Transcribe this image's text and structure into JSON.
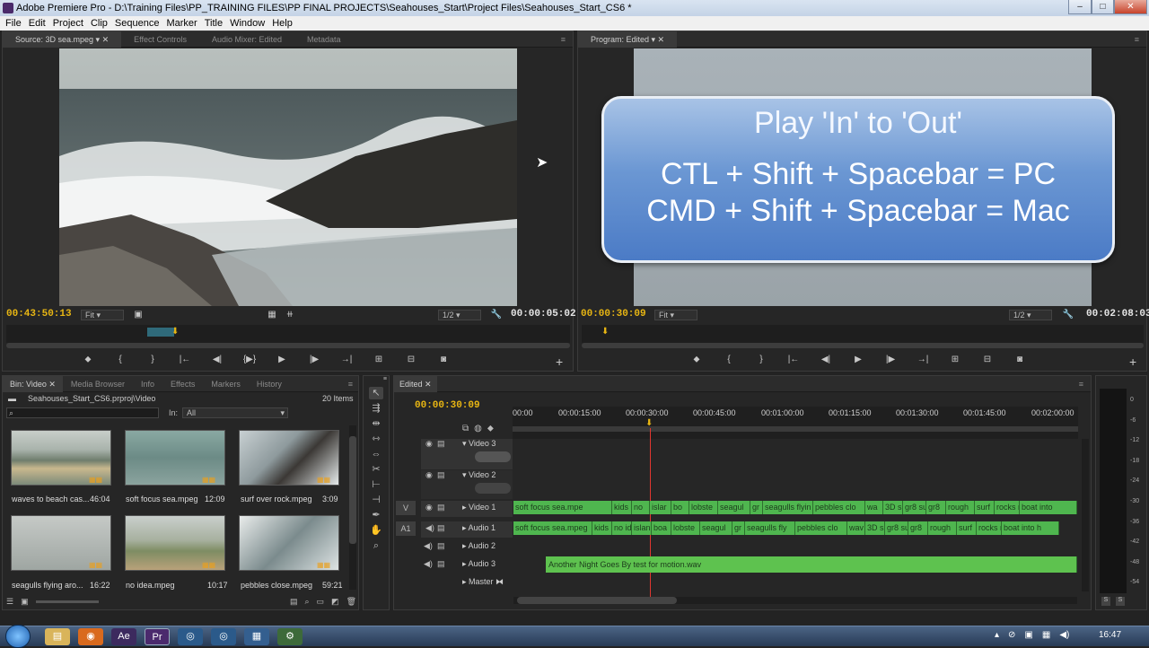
{
  "window": {
    "title": "Adobe Premiere Pro - D:\\Training Files\\PP_TRAINING FILES\\PP FINAL PROJECTS\\Seahouses_Start\\Project Files\\Seahouses_Start_CS6 *",
    "minimize": "–",
    "maximize": "□",
    "close": "✕"
  },
  "menu": [
    "File",
    "Edit",
    "Project",
    "Clip",
    "Sequence",
    "Marker",
    "Title",
    "Window",
    "Help"
  ],
  "source": {
    "tabs": [
      "Source: 3D sea.mpeg",
      "Effect Controls",
      "Audio Mixer: Edited",
      "Metadata"
    ],
    "timecode_in": "00:43:50:13",
    "fit": "Fit",
    "resolution": "1/2",
    "duration": "00:00:05:02"
  },
  "program": {
    "tab": "Program: Edited",
    "timecode": "00:00:30:09",
    "fit": "Fit",
    "resolution": "1/2",
    "duration": "00:02:08:03",
    "overlay": {
      "title": "Play 'In' to 'Out'",
      "line1": "CTL + Shift + Spacebar = PC",
      "line2": "CMD + Shift + Spacebar = Mac"
    }
  },
  "project": {
    "tabs": [
      "Bin: Video",
      "Media Browser",
      "Info",
      "Effects",
      "Markers",
      "History"
    ],
    "path": "Seahouses_Start_CS6.prproj\\Video",
    "count": "20 Items",
    "in_label": "In:",
    "in_value": "All",
    "items": [
      {
        "name": "waves to beach cas...",
        "dur": "46:04"
      },
      {
        "name": "soft focus sea.mpeg",
        "dur": "12:09"
      },
      {
        "name": "surf over rock.mpeg",
        "dur": "3:09"
      },
      {
        "name": "seagulls flying aro...",
        "dur": "16:22"
      },
      {
        "name": "no idea.mpeg",
        "dur": "10:17"
      },
      {
        "name": "pebbles close.mpeg",
        "dur": "59:21"
      }
    ]
  },
  "timeline": {
    "tab": "Edited",
    "timecode": "00:00:30:09",
    "ruler": [
      "00:00",
      "00:00:15:00",
      "00:00:30:00",
      "00:00:45:00",
      "00:01:00:00",
      "00:01:15:00",
      "00:01:30:00",
      "00:01:45:00",
      "00:02:00:00"
    ],
    "tracks": [
      "Video 3",
      "Video 2",
      "Video 1",
      "Audio 1",
      "Audio 2",
      "Audio 3",
      "Master"
    ],
    "track_letters": {
      "v": "V",
      "a": "A1"
    },
    "video1_clips": [
      "soft focus sea.mpe",
      "kids",
      "no",
      "islar",
      "bo",
      "lobste",
      "seagul",
      "gr",
      "seagulls flyin",
      "pebbles clo",
      "wa",
      "3D s",
      "gr8 su",
      "gr8",
      "rough",
      "surf",
      "rocks r",
      "boat into"
    ],
    "audio1_clips": [
      "soft focus sea.mpeg",
      "kids",
      "no id",
      "islan",
      "boa",
      "lobste",
      "seagul",
      "gr",
      "seagulls fly",
      "pebbles clo",
      "wav",
      "3D s",
      "gr8 su",
      "gr8",
      "rough",
      "surf",
      "rocks r",
      "boat into h"
    ],
    "audio3_clip": "Another Night Goes By test for motion.wav"
  },
  "meter": {
    "scale": [
      "0",
      "-6",
      "-12",
      "-18",
      "-24",
      "-30",
      "-36",
      "-42",
      "-48",
      "-54"
    ],
    "s1": "S",
    "s2": "S"
  },
  "taskbar": {
    "clock": "16:47"
  },
  "colors": {
    "accent": "#e8b613",
    "clip_green": "#4fb64f",
    "overlay_blue": "#4f7ec5",
    "playhead": "#e0372f"
  }
}
